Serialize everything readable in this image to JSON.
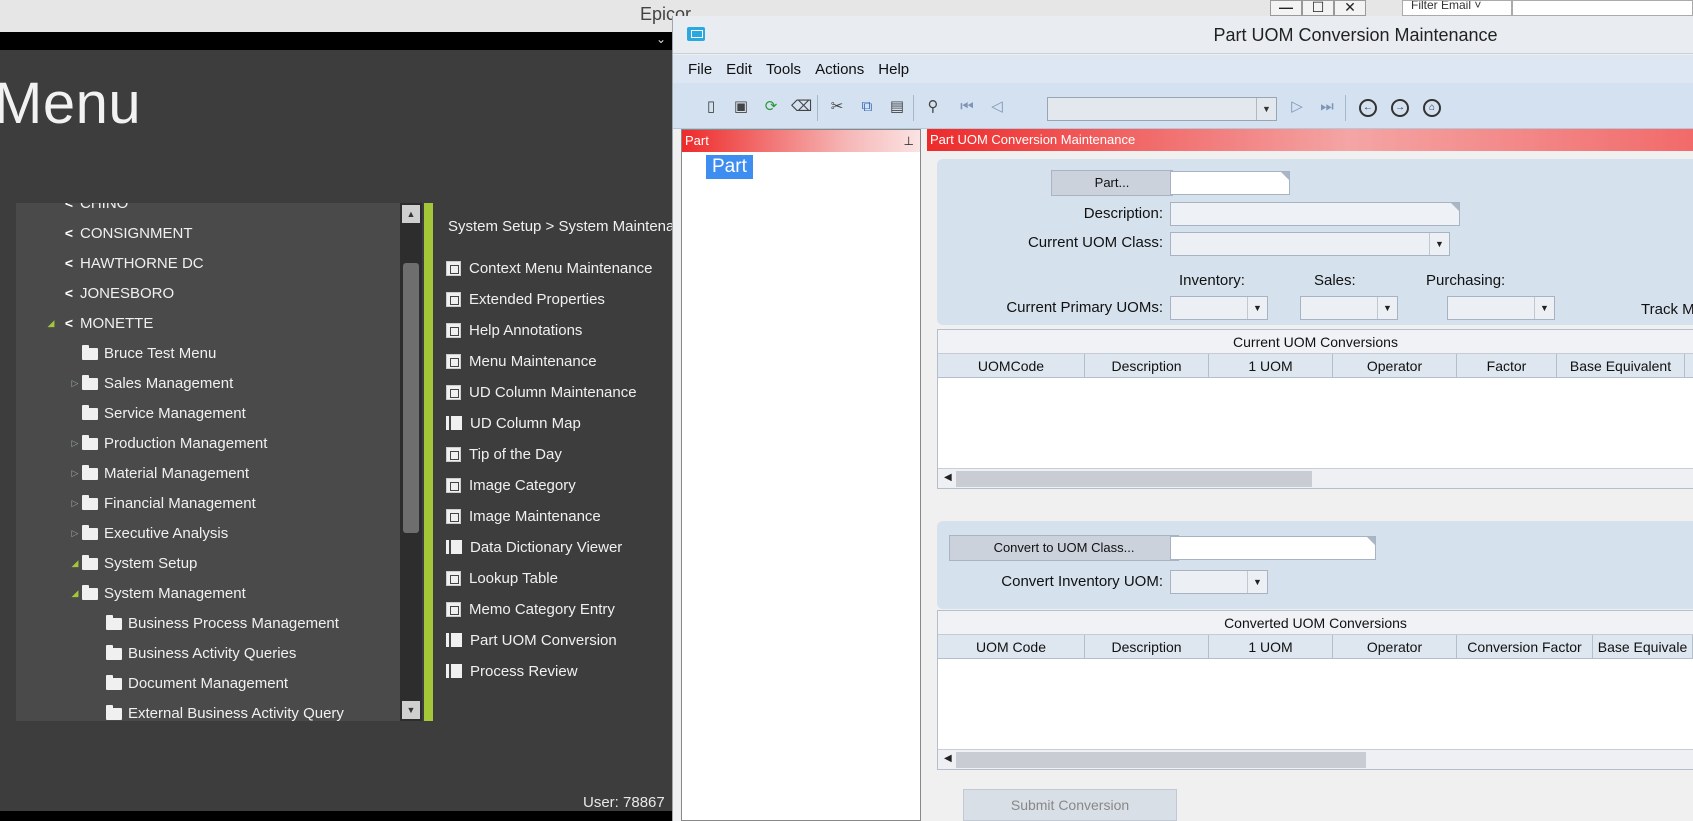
{
  "epicor": {
    "window_title": "Epicor",
    "controls": [
      "—",
      "☐",
      "✕"
    ],
    "filter_label": "Filter Email ˅",
    "menu_title": "Menu",
    "tree": [
      {
        "label": "CHINO",
        "type": "company",
        "indent": 0,
        "expander": "none"
      },
      {
        "label": "CONSIGNMENT",
        "type": "company",
        "indent": 0,
        "expander": "none"
      },
      {
        "label": "HAWTHORNE DC",
        "type": "company",
        "indent": 0,
        "expander": "none"
      },
      {
        "label": "JONESBORO",
        "type": "company",
        "indent": 0,
        "expander": "none"
      },
      {
        "label": "MONETTE",
        "type": "company",
        "indent": 0,
        "expander": "open"
      },
      {
        "label": "Bruce Test Menu",
        "type": "folder",
        "indent": 1,
        "expander": "none"
      },
      {
        "label": "Sales Management",
        "type": "folder",
        "indent": 1,
        "expander": "closed"
      },
      {
        "label": "Service Management",
        "type": "folder",
        "indent": 1,
        "expander": "none"
      },
      {
        "label": "Production Management",
        "type": "folder",
        "indent": 1,
        "expander": "closed"
      },
      {
        "label": "Material Management",
        "type": "folder",
        "indent": 1,
        "expander": "closed"
      },
      {
        "label": "Financial Management",
        "type": "folder",
        "indent": 1,
        "expander": "closed"
      },
      {
        "label": "Executive Analysis",
        "type": "folder",
        "indent": 1,
        "expander": "closed"
      },
      {
        "label": "System Setup",
        "type": "folder",
        "indent": 1,
        "expander": "open"
      },
      {
        "label": "System Management",
        "type": "folder",
        "indent": 1,
        "expander": "open"
      },
      {
        "label": "Business Process Management",
        "type": "folder",
        "indent": 2,
        "expander": "none"
      },
      {
        "label": "Business Activity Queries",
        "type": "folder",
        "indent": 2,
        "expander": "none"
      },
      {
        "label": "Document Management",
        "type": "folder",
        "indent": 2,
        "expander": "none"
      },
      {
        "label": "External Business Activity Query",
        "type": "folder",
        "indent": 2,
        "expander": "none"
      }
    ],
    "breadcrumb": "System Setup > System Maintena",
    "items": [
      {
        "label": "Context Menu Maintenance",
        "icon": "document-icon"
      },
      {
        "label": "Extended Properties",
        "icon": "document-icon"
      },
      {
        "label": "Help Annotations",
        "icon": "document-icon"
      },
      {
        "label": "Menu Maintenance",
        "icon": "document-icon"
      },
      {
        "label": "UD Column Maintenance",
        "icon": "document-icon"
      },
      {
        "label": "UD Column Map",
        "icon": "grid-icon"
      },
      {
        "label": "Tip of the Day",
        "icon": "document-icon"
      },
      {
        "label": "Image Category",
        "icon": "document-icon"
      },
      {
        "label": "Image Maintenance",
        "icon": "document-icon"
      },
      {
        "label": "Data Dictionary Viewer",
        "icon": "grid-icon"
      },
      {
        "label": "Lookup Table",
        "icon": "document-icon"
      },
      {
        "label": "Memo Category Entry",
        "icon": "document-icon"
      },
      {
        "label": "Part UOM Conversion",
        "icon": "grid-icon"
      },
      {
        "label": "Process Review",
        "icon": "grid-icon"
      }
    ],
    "user_label": "User:  78867"
  },
  "uom": {
    "window_title": "Part UOM Conversion Maintenance",
    "menus": [
      "File",
      "Edit",
      "Tools",
      "Actions",
      "Help"
    ],
    "left_panel_title": "Part",
    "tree_node": "Part",
    "main_panel_title": "Part UOM Conversion Maintenance",
    "part_button": "Part...",
    "description_label": "Description:",
    "current_uom_class_label": "Current UOM Class:",
    "inventory_label": "Inventory:",
    "sales_label": "Sales:",
    "purchasing_label": "Purchasing:",
    "current_primary_uoms_label": "Current Primary UOMs:",
    "track_label": "Track M",
    "current_grid": {
      "title": "Current UOM Conversions",
      "columns": [
        "UOMCode",
        "Description",
        "1 UOM",
        "Operator",
        "Factor",
        "Base Equivalent"
      ]
    },
    "convert_button": "Convert to UOM Class...",
    "convert_inventory_label": "Convert Inventory UOM:",
    "converted_grid": {
      "title": "Converted UOM Conversions",
      "columns": [
        "UOM Code",
        "Description",
        "1 UOM",
        "Operator",
        "Conversion Factor",
        "Base Equivale"
      ]
    },
    "submit_button": "Submit Conversion"
  },
  "colors": {
    "accent_green": "#a4c639",
    "header_red": "#ee2a2a",
    "selection_blue": "#3d8ef0"
  }
}
